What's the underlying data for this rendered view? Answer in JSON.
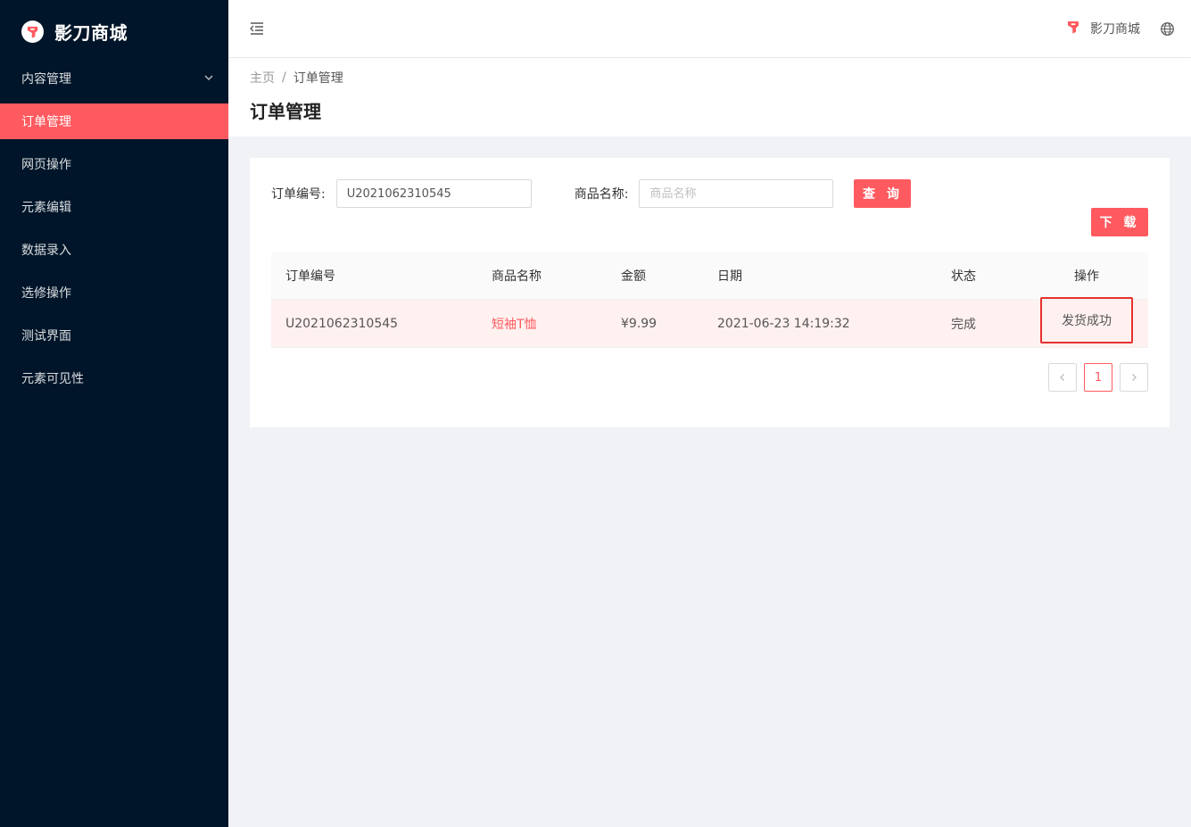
{
  "brand": {
    "name": "影刀商城"
  },
  "sidebar": {
    "items": [
      {
        "label": "内容管理",
        "has_children": true
      },
      {
        "label": "订单管理",
        "active": true
      },
      {
        "label": "网页操作"
      },
      {
        "label": "元素编辑"
      },
      {
        "label": "数据录入"
      },
      {
        "label": "选修操作"
      },
      {
        "label": "测试界面"
      },
      {
        "label": "元素可见性"
      }
    ]
  },
  "header": {
    "brand_label": "影刀商城",
    "fold_icon": "menu-fold-icon",
    "language_icon": "globe-icon"
  },
  "breadcrumb": {
    "home": "主页",
    "separator": "/",
    "current": "订单管理"
  },
  "page": {
    "title": "订单管理"
  },
  "filters": {
    "order_no_label": "订单编号:",
    "order_no_value": "U2021062310545",
    "product_label": "商品名称:",
    "product_placeholder": "商品名称",
    "query_button": "查 询",
    "download_button": "下 载"
  },
  "table": {
    "columns": [
      "订单编号",
      "商品名称",
      "金额",
      "日期",
      "状态",
      "操作"
    ],
    "rows": [
      {
        "order_no": "U2021062310545",
        "product": "短袖T恤",
        "amount": "¥9.99",
        "date": "2021-06-23 14:19:32",
        "status": "完成",
        "action": "发货成功"
      }
    ]
  },
  "pagination": {
    "current": "1"
  },
  "colors": {
    "accent": "#ff5a5f",
    "sidebar_bg": "#001529",
    "highlight_box": "#e8312e"
  }
}
